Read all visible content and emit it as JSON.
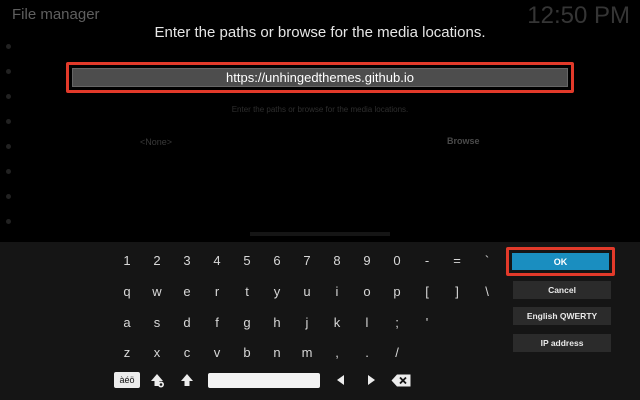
{
  "background": {
    "window_title": "File manager",
    "clock": "12:50 PM",
    "hint": "Enter the paths or browse for the media locations.",
    "none_label": "<None>",
    "browse_label": "Browse"
  },
  "dialog": {
    "heading": "Enter the paths or browse for the media locations.",
    "input_value": "https://unhingedthemes.github.io"
  },
  "keyboard": {
    "row1": [
      "1",
      "2",
      "3",
      "4",
      "5",
      "6",
      "7",
      "8",
      "9",
      "0",
      "-",
      "=",
      "`"
    ],
    "row2": [
      "q",
      "w",
      "e",
      "r",
      "t",
      "y",
      "u",
      "i",
      "o",
      "p",
      "[",
      "]",
      "\\"
    ],
    "row3": [
      "a",
      "s",
      "d",
      "f",
      "g",
      "h",
      "j",
      "k",
      "l",
      ";",
      "'"
    ],
    "row4": [
      "z",
      "x",
      "c",
      "v",
      "b",
      "n",
      "m",
      ",",
      ".",
      "/"
    ],
    "accent_key_label": "àéö",
    "icons": [
      "accent-toggle",
      "shift-lock-icon",
      "shift-icon",
      "space-bar",
      "arrow-left-icon",
      "arrow-right-icon",
      "backspace-icon"
    ]
  },
  "buttons": {
    "ok": "OK",
    "cancel": "Cancel",
    "layout": "English QWERTY",
    "ip": "IP address"
  },
  "colors": {
    "highlight": "#e23a2a",
    "ok_button": "#1a8ec0"
  }
}
